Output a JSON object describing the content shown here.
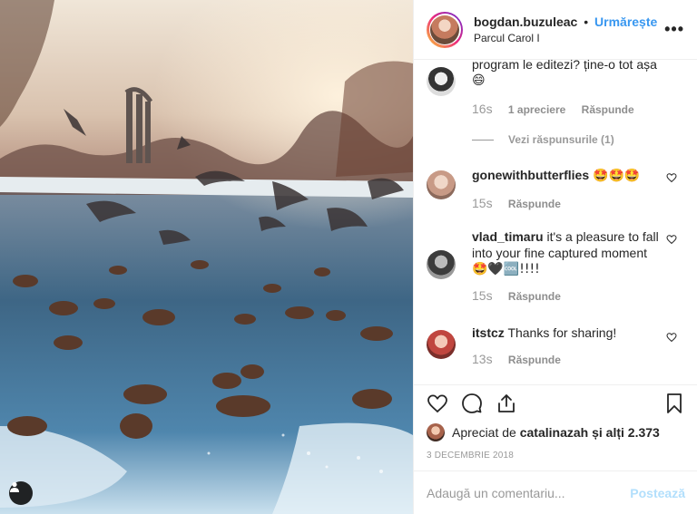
{
  "post": {
    "username": "bogdan.buzuleac",
    "separator": "•",
    "follow_label": "Urmărește",
    "location": "Parcul Carol I",
    "more_glyph": "•••"
  },
  "comments": [
    {
      "user": "",
      "text": "program le editezi? ține-o tot așa",
      "emoji": "😄",
      "time": "16s",
      "likes": "1 apreciere",
      "reply": "Răspunde"
    },
    {
      "view_replies": "Vezi răspunsurile (1)"
    },
    {
      "user": "gonewithbutterflies",
      "text": "",
      "emoji": "🤩🤩🤩",
      "time": "15s",
      "reply": "Răspunde"
    },
    {
      "user": "vlad_timaru",
      "text": "it's a pleasure to fall into your fine captured moment",
      "emoji": "🤩🖤🆒!!!!",
      "time": "15s",
      "reply": "Răspunde"
    },
    {
      "user": "itstcz",
      "text": "Thanks for sharing!",
      "time": "13s",
      "reply": "Răspunde"
    }
  ],
  "liked_by": {
    "prefix": "Apreciat de",
    "user": "catalinazah",
    "suffix": "și alți 2.373"
  },
  "date": "3 DECEMBRIE 2018",
  "add_comment": {
    "placeholder": "Adaugă un comentariu...",
    "post_label": "Postează"
  },
  "colors": {
    "link": "#3897f0",
    "post_disabled": "#b2dffc",
    "muted": "#999999"
  },
  "icons": [
    "user-tag-icon",
    "more-icon",
    "heart-icon",
    "comment-icon",
    "share-icon",
    "bookmark-icon"
  ]
}
